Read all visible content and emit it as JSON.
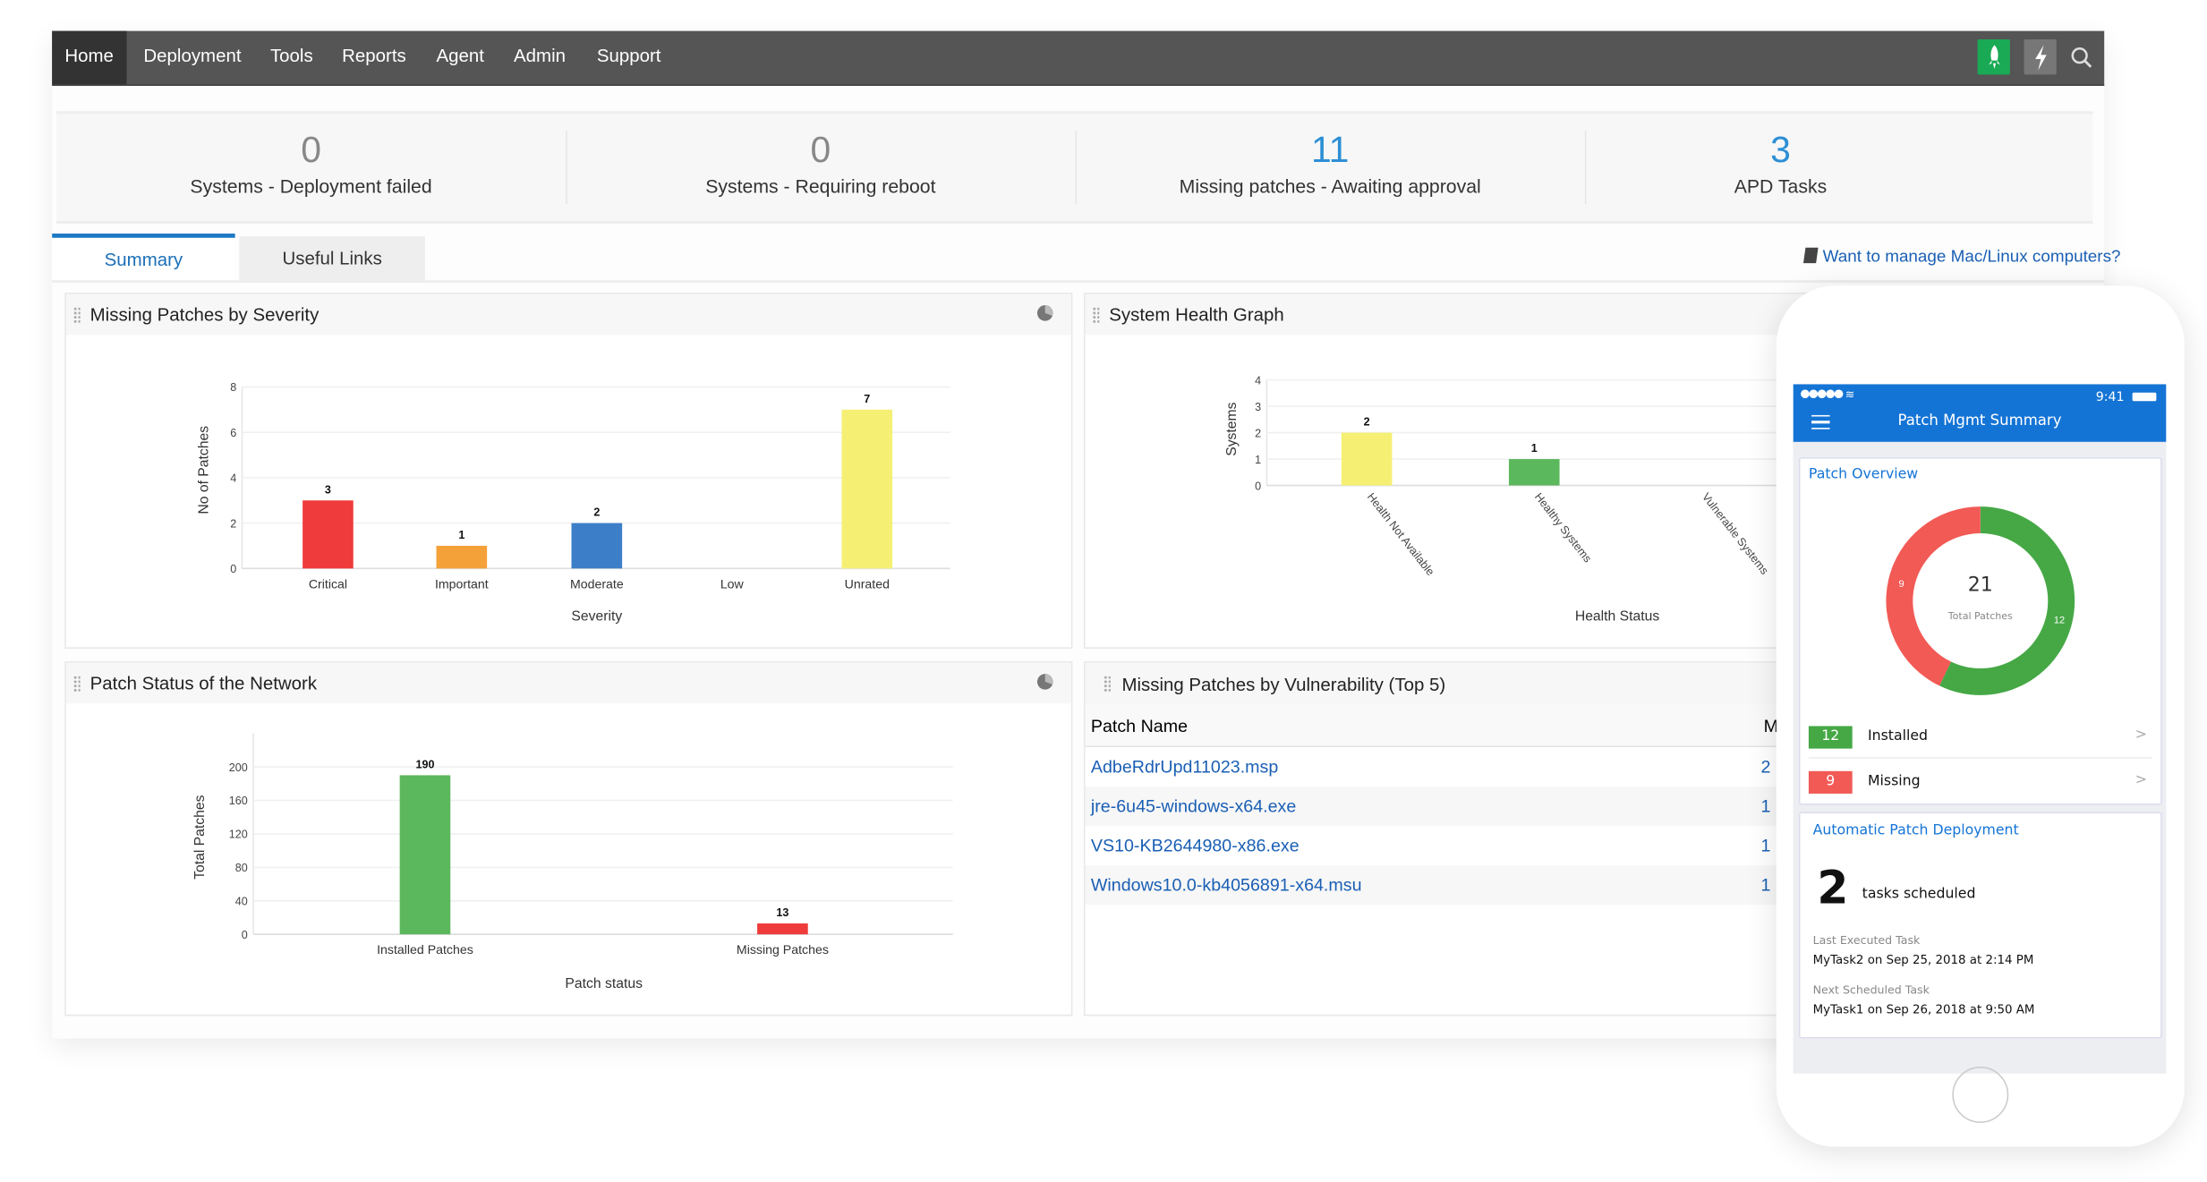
{
  "nav": {
    "items": [
      "Home",
      "Deployment",
      "Tools",
      "Reports",
      "Agent",
      "Admin",
      "Support"
    ],
    "active": "Home",
    "icons": [
      "rocket-icon",
      "lightning-icon",
      "search-icon"
    ]
  },
  "stats": [
    {
      "value": "0",
      "label": "Systems - Deployment failed",
      "color": "#888888"
    },
    {
      "value": "0",
      "label": "Systems - Requiring reboot",
      "color": "#888888"
    },
    {
      "value": "11",
      "label": "Missing patches - Awaiting approval",
      "color": "#2d8fd5"
    },
    {
      "value": "3",
      "label": "APD Tasks",
      "color": "#2d8fd5"
    }
  ],
  "tabs": {
    "summary": "Summary",
    "useful_links": "Useful Links"
  },
  "mac_linux_link": "Want to manage Mac/Linux computers?",
  "panels": {
    "severity": "Missing Patches by Severity",
    "health": "System Health Graph",
    "network": "Patch Status of the Network",
    "vulnerability": "Missing Patches by Vulnerability (Top 5)"
  },
  "chart_data": [
    {
      "type": "bar",
      "title": "Missing Patches by Severity",
      "xlabel": "Severity",
      "ylabel": "No of Patches",
      "categories": [
        "Critical",
        "Important",
        "Moderate",
        "Low",
        "Unrated"
      ],
      "values": [
        3,
        1,
        2,
        0,
        7
      ],
      "colors": [
        "#ef3b3b",
        "#f5a13a",
        "#3c7fc8",
        "#cccccc",
        "#f5f074"
      ],
      "yticks": [
        0,
        2,
        4,
        6,
        8
      ],
      "ylim": [
        0,
        8
      ],
      "grid": true
    },
    {
      "type": "bar",
      "title": "System Health Graph",
      "xlabel": "Health Status",
      "ylabel": "Systems",
      "categories": [
        "Health Not Available",
        "Healthy Systems",
        "Vulnerable Systems"
      ],
      "values": [
        2,
        1,
        0
      ],
      "colors": [
        "#f5f074",
        "#5cb85c",
        "#ef3b3b"
      ],
      "yticks": [
        0,
        1,
        2,
        3,
        4
      ],
      "ylim": [
        0,
        4
      ],
      "grid": true
    },
    {
      "type": "bar",
      "title": "Patch Status of the Network",
      "xlabel": "Patch status",
      "ylabel": "Total Patches",
      "categories": [
        "Installed Patches",
        "Missing Patches"
      ],
      "values": [
        190,
        13
      ],
      "colors": [
        "#5cb85c",
        "#ef3b3b"
      ],
      "yticks": [
        0,
        40,
        80,
        120,
        160,
        200
      ],
      "ylim": [
        0,
        240
      ],
      "grid": true
    }
  ],
  "vuln_table": {
    "headers": [
      "Patch Name",
      "M"
    ],
    "rows": [
      {
        "name": "AdbeRdrUpd11023.msp",
        "count": "2"
      },
      {
        "name": "jre-6u45-windows-x64.exe",
        "count": "1"
      },
      {
        "name": "VS10-KB2644980-x86.exe",
        "count": "1"
      },
      {
        "name": "Windows10.0-kb4056891-x64.msu",
        "count": "1"
      }
    ]
  },
  "phone": {
    "time": "9:41",
    "title": "Patch Mgmt Summary",
    "overview_title": "Patch Overview",
    "total": "21",
    "total_label": "Total Patches",
    "donut": [
      {
        "label": "Installed",
        "value": 12,
        "color": "#45a845"
      },
      {
        "label": "Missing",
        "value": 9,
        "color": "#f25a55"
      }
    ],
    "installed_count": "12",
    "installed_label": "Installed",
    "missing_count": "9",
    "missing_label": "Missing",
    "apd_title": "Automatic Patch Deployment",
    "tasks_count": "2",
    "tasks_label": "tasks scheduled",
    "last_label": "Last Executed Task",
    "last_value": "MyTask2 on Sep 25, 2018 at 2:14 PM",
    "next_label": "Next Scheduled Task",
    "next_value": "MyTask1 on Sep 26, 2018 at 9:50 AM"
  }
}
